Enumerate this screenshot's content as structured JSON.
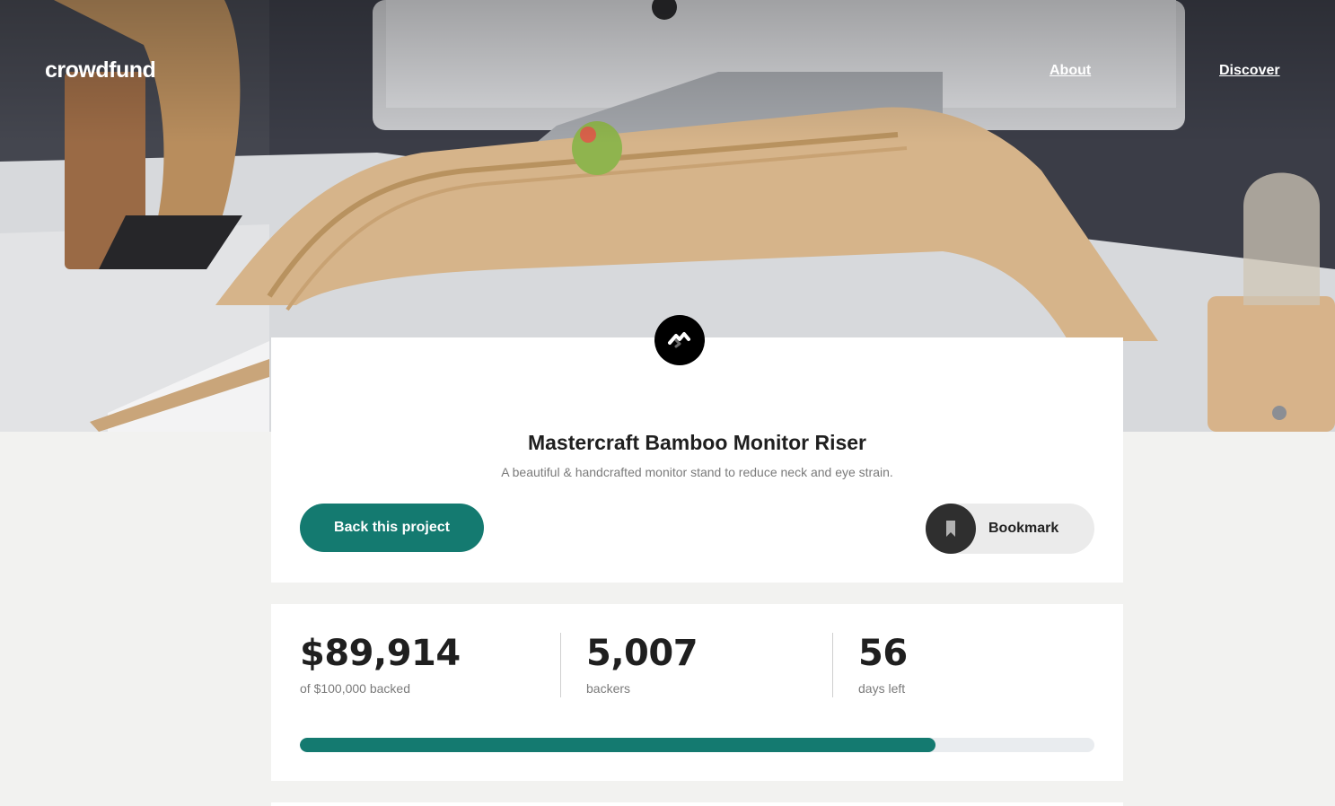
{
  "brand": {
    "name": "crowdfund"
  },
  "nav": {
    "about": "About",
    "discover": "Discover"
  },
  "project": {
    "title": "Mastercraft Bamboo Monitor Riser",
    "subtitle": "A beautiful & handcrafted monitor stand to reduce neck and eye strain.",
    "back_button": "Back this project",
    "bookmark_label": "Bookmark"
  },
  "stats": {
    "backed_value": "$89,914",
    "backed_label": "of $100,000 backed",
    "backers_value": "5,007",
    "backers_label": "backers",
    "days_value": "56",
    "days_label": "days left"
  },
  "progress": {
    "fraction": 0.8
  },
  "colors": {
    "accent": "#147a70",
    "bookmark_bg": "#ebebeb",
    "page_bg": "#f2f2f0",
    "track": "#e9ecef"
  },
  "icons": {
    "brand_mark": "mastercraft-logo-icon",
    "bookmark": "bookmark-icon"
  }
}
